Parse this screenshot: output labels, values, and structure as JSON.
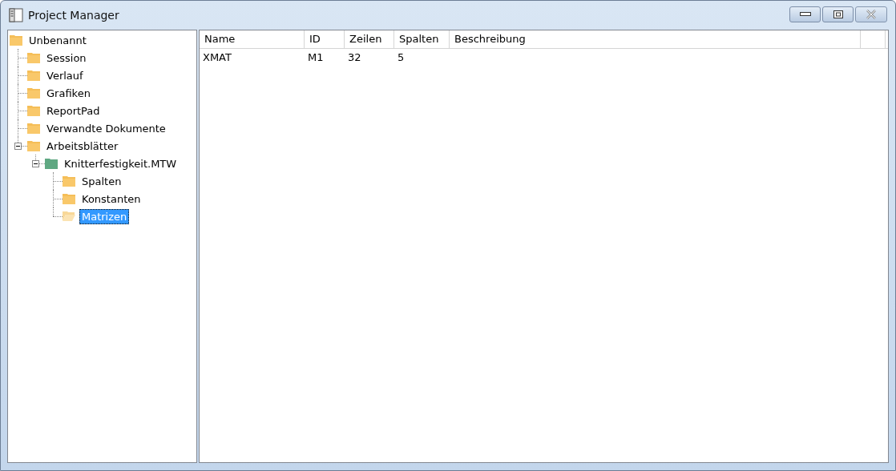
{
  "window": {
    "title": "Project Manager"
  },
  "tree": [
    {
      "label": "Unbenannt",
      "kind": "folder",
      "selected": false,
      "children": [
        {
          "label": "Session",
          "kind": "folder",
          "selected": false
        },
        {
          "label": "Verlauf",
          "kind": "folder",
          "selected": false
        },
        {
          "label": "Grafiken",
          "kind": "folder",
          "selected": false
        },
        {
          "label": "ReportPad",
          "kind": "folder",
          "selected": false
        },
        {
          "label": "Verwandte Dokumente",
          "kind": "folder",
          "selected": false
        },
        {
          "label": "Arbeitsblätter",
          "kind": "folder",
          "selected": false,
          "expanded": true,
          "children": [
            {
              "label": "Knitterfestigkeit.MTW",
              "kind": "worksheet",
              "selected": false,
              "expanded": true,
              "children": [
                {
                  "label": "Spalten",
                  "kind": "folder",
                  "selected": false
                },
                {
                  "label": "Konstanten",
                  "kind": "folder",
                  "selected": false
                },
                {
                  "label": "Matrizen",
                  "kind": "folder",
                  "selected": true
                }
              ]
            }
          ]
        }
      ]
    }
  ],
  "table": {
    "columns": [
      "Name",
      "ID",
      "Zeilen",
      "Spalten",
      "Beschreibung"
    ],
    "rows": [
      [
        "XMAT",
        "M1",
        "32",
        "5"
      ]
    ]
  }
}
